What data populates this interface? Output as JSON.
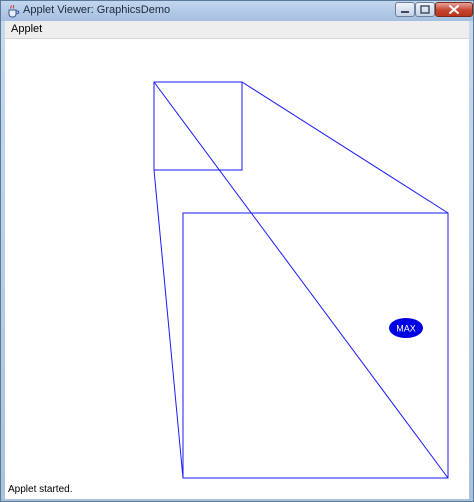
{
  "window": {
    "title": "Applet Viewer: GraphicsDemo"
  },
  "menu": {
    "items": [
      "Applet"
    ]
  },
  "canvas": {
    "stroke_color": "#1a1aff",
    "button_color": "#0000e6",
    "max_button_label": "MAX"
  },
  "status": {
    "text": "Applet started."
  },
  "icons": {
    "app": "java-cup-icon",
    "minimize": "minimize-icon",
    "maximize": "maximize-icon",
    "close": "close-icon"
  }
}
